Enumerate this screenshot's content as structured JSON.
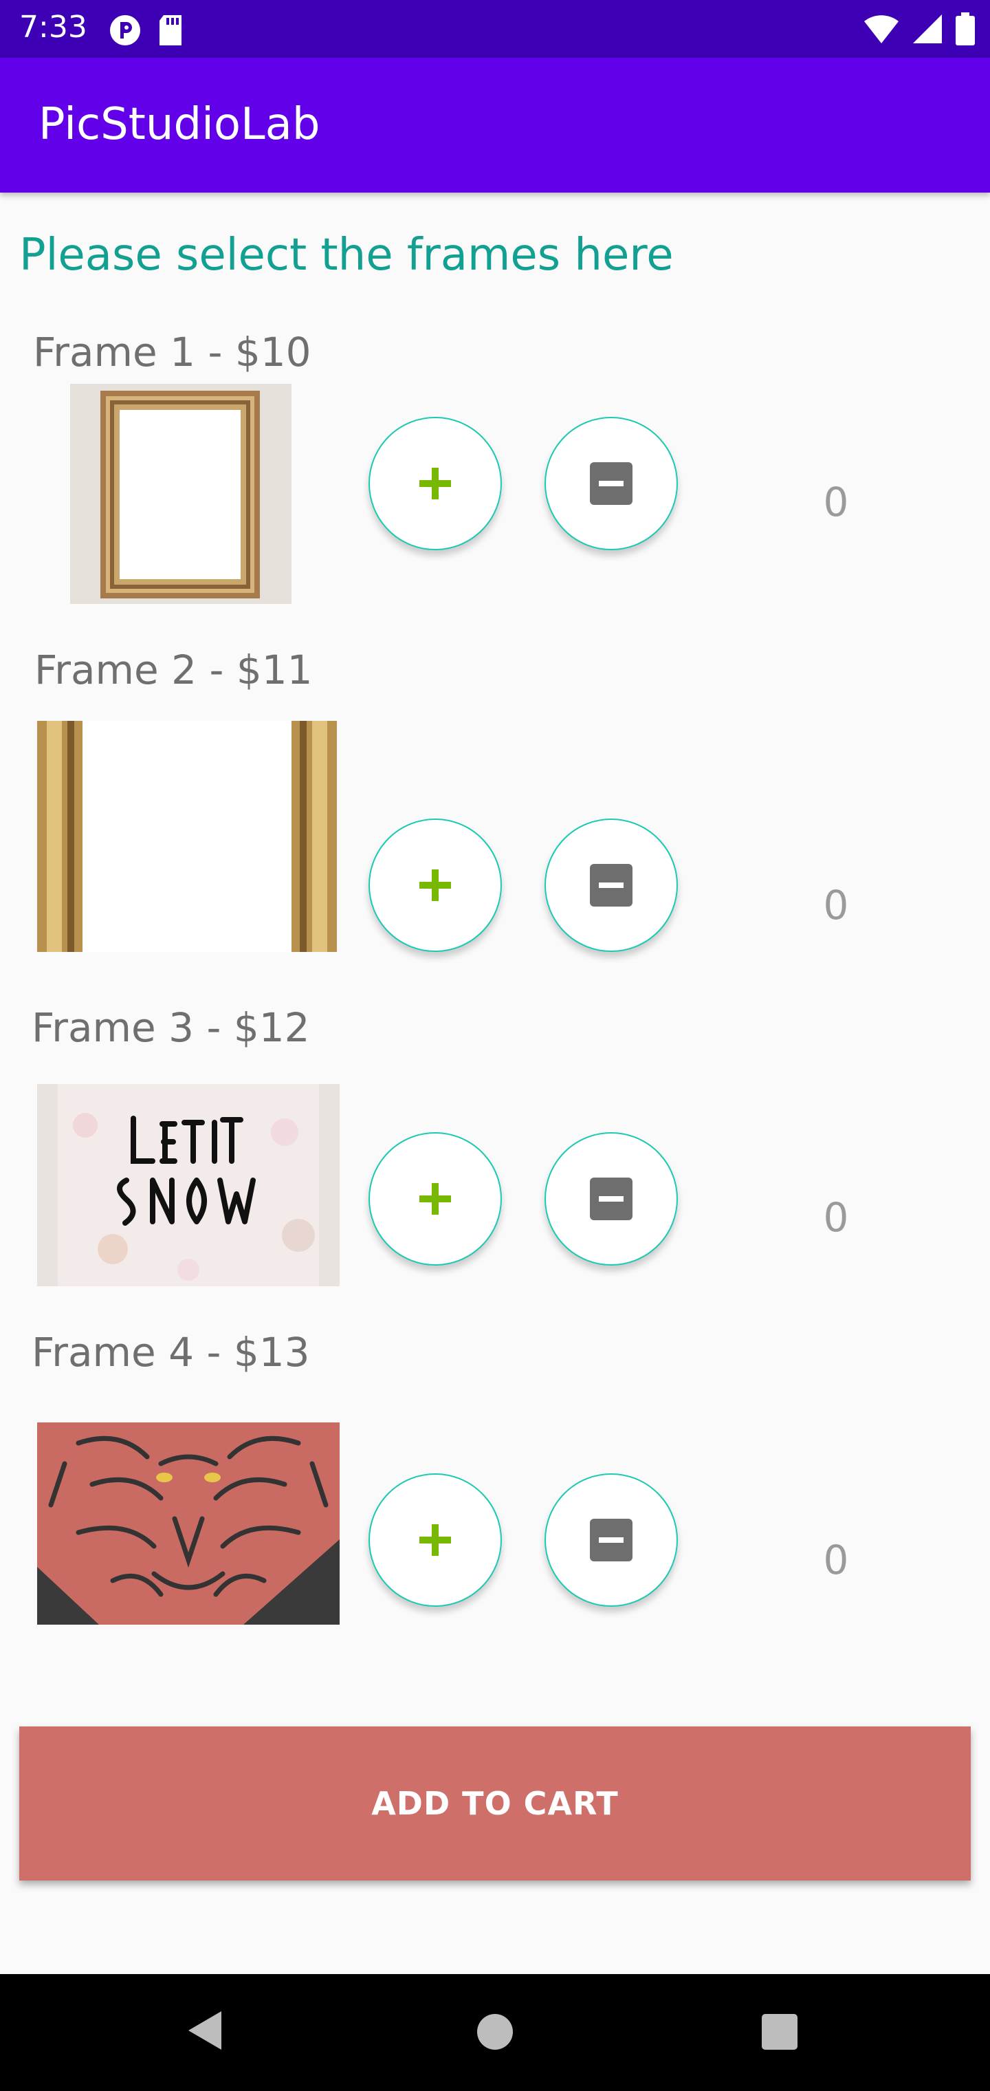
{
  "status_bar": {
    "time": "7:33",
    "left_icons": [
      "sync-status-icon",
      "sd-card-icon"
    ],
    "right_icons": [
      "wifi-icon",
      "signal-icon",
      "battery-icon"
    ]
  },
  "app_bar": {
    "title": "PicStudioLab",
    "color": "#6200ea"
  },
  "prompt": "Please select the frames here",
  "frames": [
    {
      "label": "Frame 1 - $10",
      "quantity": "0",
      "image": "ornate-gold-frame"
    },
    {
      "label": "Frame 2 - $11",
      "quantity": "0",
      "image": "gold-frame-edges"
    },
    {
      "label": "Frame 3 - $12",
      "quantity": "0",
      "image": "let-it-snow-frame"
    },
    {
      "label": "Frame 4 - $13",
      "quantity": "0",
      "image": "tiger-frame"
    }
  ],
  "icons": {
    "increment": "plus-icon",
    "decrement": "minus-icon"
  },
  "add_to_cart": {
    "label": "ADD TO CART",
    "color": "#cf6f69"
  },
  "accent_color": "#12a092",
  "nav": {
    "icons": [
      "back-icon",
      "home-icon",
      "recents-icon"
    ]
  }
}
